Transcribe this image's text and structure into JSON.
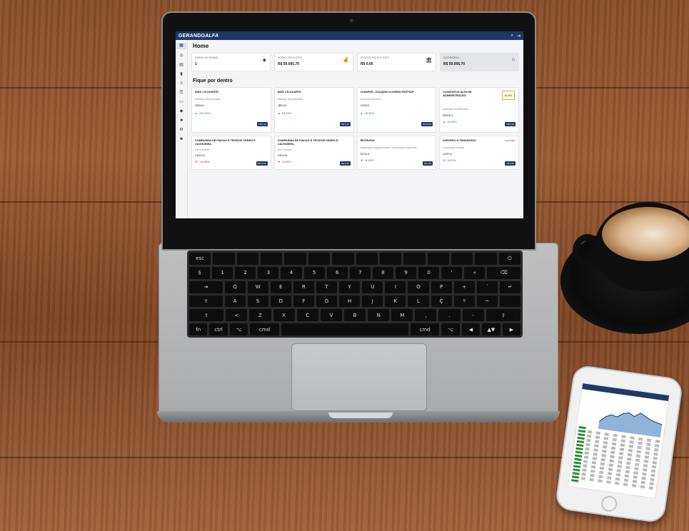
{
  "app": {
    "brand_part1": "GERANDO",
    "brand_part2": "ALFA",
    "page_title": "Home",
    "top_icons": [
      "search-icon",
      "logout-icon"
    ]
  },
  "sidebar": {
    "items": [
      "dashboard-icon",
      "radar-icon",
      "wallet-icon",
      "chart-icon",
      "list-icon",
      "document-icon",
      "video-icon",
      "shield-icon",
      "book-icon",
      "settings-icon",
      "user-icon"
    ]
  },
  "stats": [
    {
      "label": "Ativos no radar",
      "value": "1",
      "icon": "◈"
    },
    {
      "label": "Ações, FIIs e ETFs",
      "value": "R$ 59.005,70",
      "icon": "💰"
    },
    {
      "label": "Stocks, REITs e ETFs",
      "value": "R$ 0,00",
      "icon": "🏛"
    },
    {
      "label": "Patrimônio",
      "value": "R$ 59.005,70",
      "icon": "⌂"
    }
  ],
  "section_title": "Fique por dentro",
  "cards": [
    {
      "name": "INDS J B DUARTE",
      "sector": "holdings diversificadas",
      "ticker": "JBDU3",
      "change": "100,00%",
      "direction": "up",
      "tag": "R$ 1,40"
    },
    {
      "name": "INDS J B DUARTE",
      "sector": "holdings diversificadas",
      "ticker": "JBDU4",
      "change": "69,29%",
      "direction": "up",
      "tag": "R$ 1,40"
    },
    {
      "name": "JOSAPAR- JOAQUIM OLIVEIRA PARTICIP",
      "sector": "alimentos diversos",
      "ticker": "JOPA3",
      "change": "25,36%",
      "direction": "up",
      "tag": "R$ 60,00"
    },
    {
      "name": "CONSORCIO ALFA DE ADMINISTRAÇÃO",
      "sector": "holdings diversificadas",
      "ticker": "BRGE3",
      "change": "16,20%",
      "direction": "up",
      "tag": "R$ 9,30",
      "logo": "ALFA"
    },
    {
      "name": "COMPANHIA DE FIACAO E TECIDOS CEDRO E CACHOEIRA",
      "sector": "fios e tecidos",
      "ticker": "CEDO3",
      "change": "-16,98%",
      "direction": "down",
      "tag": "R$ 12,00"
    },
    {
      "name": "COMPANHIA DE FIACAO E TECIDOS CEDRO E CACHOEIRA",
      "sector": "fios e tecidos",
      "ticker": "CEDO4",
      "change": "-8,52%",
      "direction": "down",
      "tag": "R$ 9,50"
    },
    {
      "name": "RECRUSUL",
      "sector": "máquinas e equipamentos - construção e agrícolas",
      "ticker": "RCSL4",
      "change": "-8,12%",
      "direction": "down",
      "tag": "R$ 1,80"
    },
    {
      "name": "AZEVEDO & TRAVASSOS",
      "sector": "construção pesada",
      "ticker": "AZEV4",
      "change": "-8,07%",
      "direction": "down",
      "tag": "R$ 3,05",
      "logo_small": "azevedo"
    }
  ]
}
